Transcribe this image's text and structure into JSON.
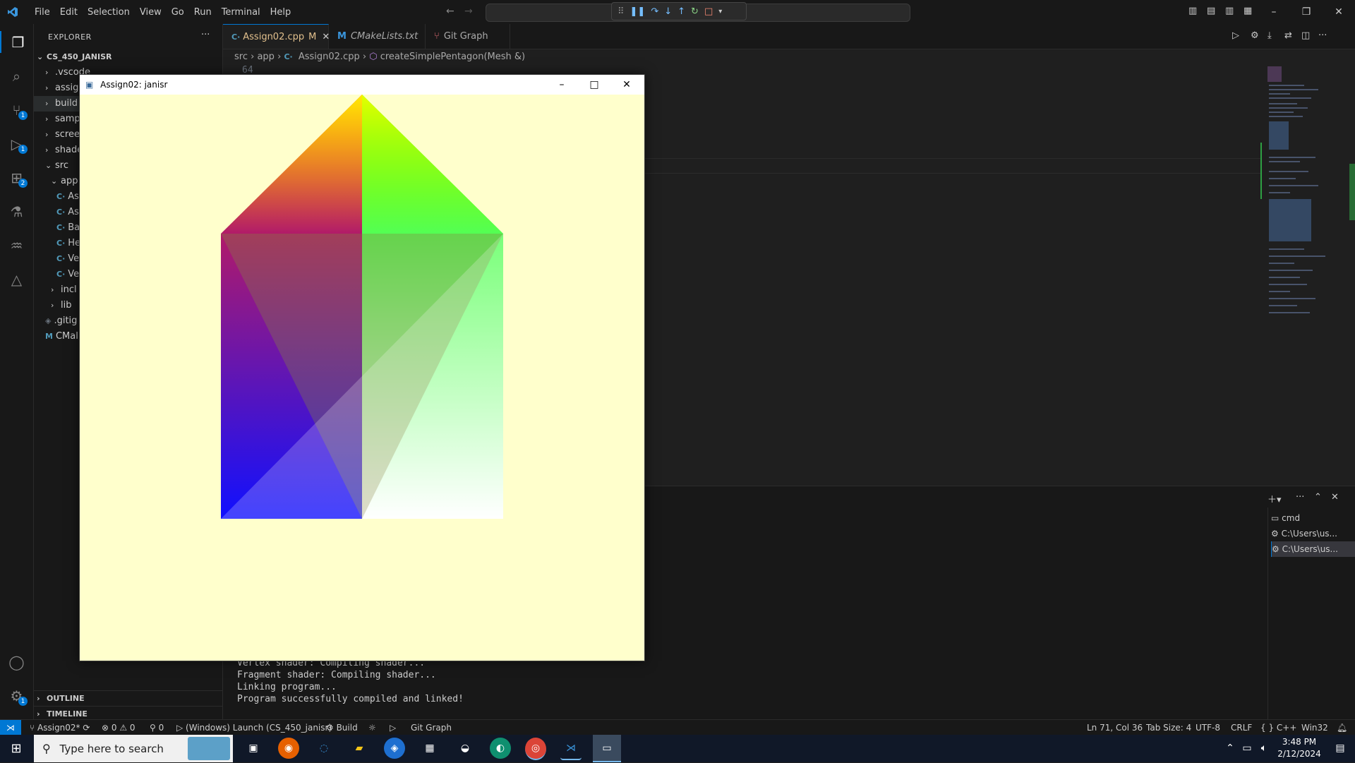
{
  "menu": [
    "File",
    "Edit",
    "Selection",
    "View",
    "Go",
    "Run",
    "Terminal",
    "Help"
  ],
  "explorer": {
    "title": "EXPLORER",
    "root": "CS_450_JANISR",
    "items": [
      {
        "label": ".vscode",
        "type": "folder"
      },
      {
        "label": "assig",
        "type": "folder"
      },
      {
        "label": "build",
        "type": "folder"
      },
      {
        "label": "samp",
        "type": "folder"
      },
      {
        "label": "scree",
        "type": "folder"
      },
      {
        "label": "shade",
        "type": "folder"
      },
      {
        "label": "src",
        "type": "folder-open"
      },
      {
        "label": "app",
        "type": "folder-open"
      },
      {
        "label": "As",
        "type": "cpp"
      },
      {
        "label": "As",
        "type": "cpp"
      },
      {
        "label": "Ba",
        "type": "cpp"
      },
      {
        "label": "He",
        "type": "cpp"
      },
      {
        "label": "Ve",
        "type": "cpp"
      },
      {
        "label": "Ve",
        "type": "cpp"
      },
      {
        "label": "incl",
        "type": "folder"
      },
      {
        "label": "lib",
        "type": "folder"
      },
      {
        "label": ".gitig",
        "type": "file"
      },
      {
        "label": "CMal",
        "type": "cmake"
      }
    ],
    "outline": "OUTLINE",
    "timeline": "TIMELINE"
  },
  "tabs": [
    {
      "label": "Assign02.cpp",
      "mod": "M"
    },
    {
      "label": "CMakeLists.txt"
    },
    {
      "label": "Git Graph"
    }
  ],
  "breadcrumb": {
    "b1": "src",
    "b2": "app",
    "b3": "Assign02.cpp",
    "b4": "createSimplePentagon(Mesh &)"
  },
  "editor": {
    "line_number": "64"
  },
  "gl_window": {
    "title": "Assign02: janisr"
  },
  "terminal": {
    "lines": [
      "Vertex shader: Compiling shader...",
      "Fragment shader: Compiling shader...",
      "Linking program...",
      "Program successfully compiled and linked!"
    ],
    "list": [
      "cmd",
      "C:\\Users\\us...",
      "C:\\Users\\us..."
    ]
  },
  "statusbar": {
    "branch": "Assign02*",
    "errors": "0",
    "warnings": "0",
    "ports": "0",
    "launch": "(Windows) Launch (CS_450_janisr)",
    "build": "Build",
    "git_graph": "Git Graph",
    "position": "Ln 71, Col 36",
    "tab_size": "Tab Size: 4",
    "encoding": "UTF-8",
    "eol": "CRLF",
    "language": "C++",
    "platform": "Win32"
  },
  "taskbar": {
    "search_placeholder": "Type here to search",
    "time": "3:48 PM",
    "date": "2/12/2024"
  },
  "badges": {
    "scm": "1",
    "debug": "1",
    "ext": "2",
    "settings": "1"
  }
}
